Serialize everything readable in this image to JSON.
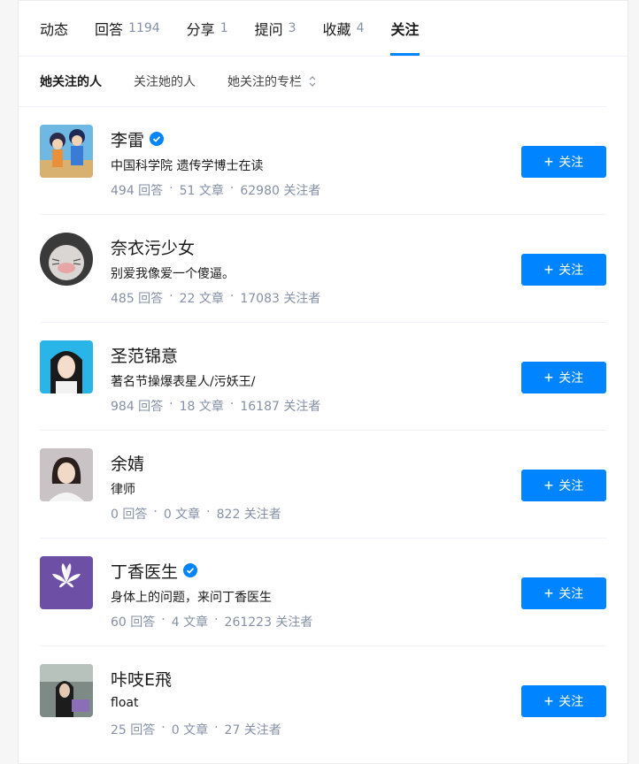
{
  "tabs": [
    {
      "label": "动态",
      "count": ""
    },
    {
      "label": "回答",
      "count": "1194"
    },
    {
      "label": "分享",
      "count": "1"
    },
    {
      "label": "提问",
      "count": "3"
    },
    {
      "label": "收藏",
      "count": "4"
    },
    {
      "label": "关注",
      "count": ""
    }
  ],
  "subtabs": [
    "她关注的人",
    "关注她的人",
    "她关注的专栏"
  ],
  "follow_label": "关注",
  "accent": "#0084ff",
  "users": [
    {
      "name": "李雷",
      "verified": true,
      "bio": "中国科学院 遗传学博士在读",
      "answers": "494 回答",
      "articles": "51 文章",
      "followers": "62980 关注者"
    },
    {
      "name": "奈衣污少女",
      "verified": false,
      "bio": "别爱我像爱一个傻逼。",
      "answers": "485 回答",
      "articles": "22 文章",
      "followers": "17083 关注者"
    },
    {
      "name": "圣范锦意",
      "verified": false,
      "bio": "著名节操爆表星人/污妖王/",
      "answers": "984 回答",
      "articles": "18 文章",
      "followers": "16187 关注者"
    },
    {
      "name": "余婧",
      "verified": false,
      "bio": "律师",
      "answers": "0 回答",
      "articles": "0 文章",
      "followers": "822 关注者"
    },
    {
      "name": "丁香医生",
      "verified": true,
      "bio": "身体上的问题，来问丁香医生",
      "answers": "60 回答",
      "articles": "4 文章",
      "followers": "261223 关注者"
    },
    {
      "name": "咔吱E飛",
      "verified": false,
      "bio": "float",
      "answers": "25 回答",
      "articles": "0 文章",
      "followers": "27 关注者"
    }
  ],
  "dingxiang_logo_text": "丁香医生"
}
